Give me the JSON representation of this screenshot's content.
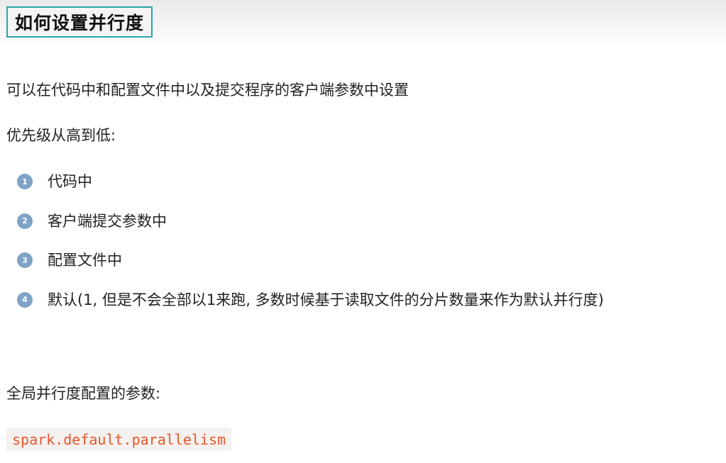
{
  "heading": "如何设置并行度",
  "intro": "可以在代码中和配置文件中以及提交程序的客户端参数中设置",
  "priority_label": "优先级从高到低:",
  "priority_items": [
    {
      "number": "1",
      "text": "代码中"
    },
    {
      "number": "2",
      "text": "客户端提交参数中"
    },
    {
      "number": "3",
      "text": "配置文件中"
    },
    {
      "number": "4",
      "text": "默认(1, 但是不会全部以1来跑, 多数时候基于读取文件的分片数量来作为默认并行度)"
    }
  ],
  "global_label": "全局并行度配置的参数:",
  "config_param": "spark.default.parallelism",
  "colors": {
    "heading_border": "#2aa3ad",
    "badge": "#7fa3c7",
    "code_text": "#e4572e",
    "code_background": "#f4f1ee"
  }
}
